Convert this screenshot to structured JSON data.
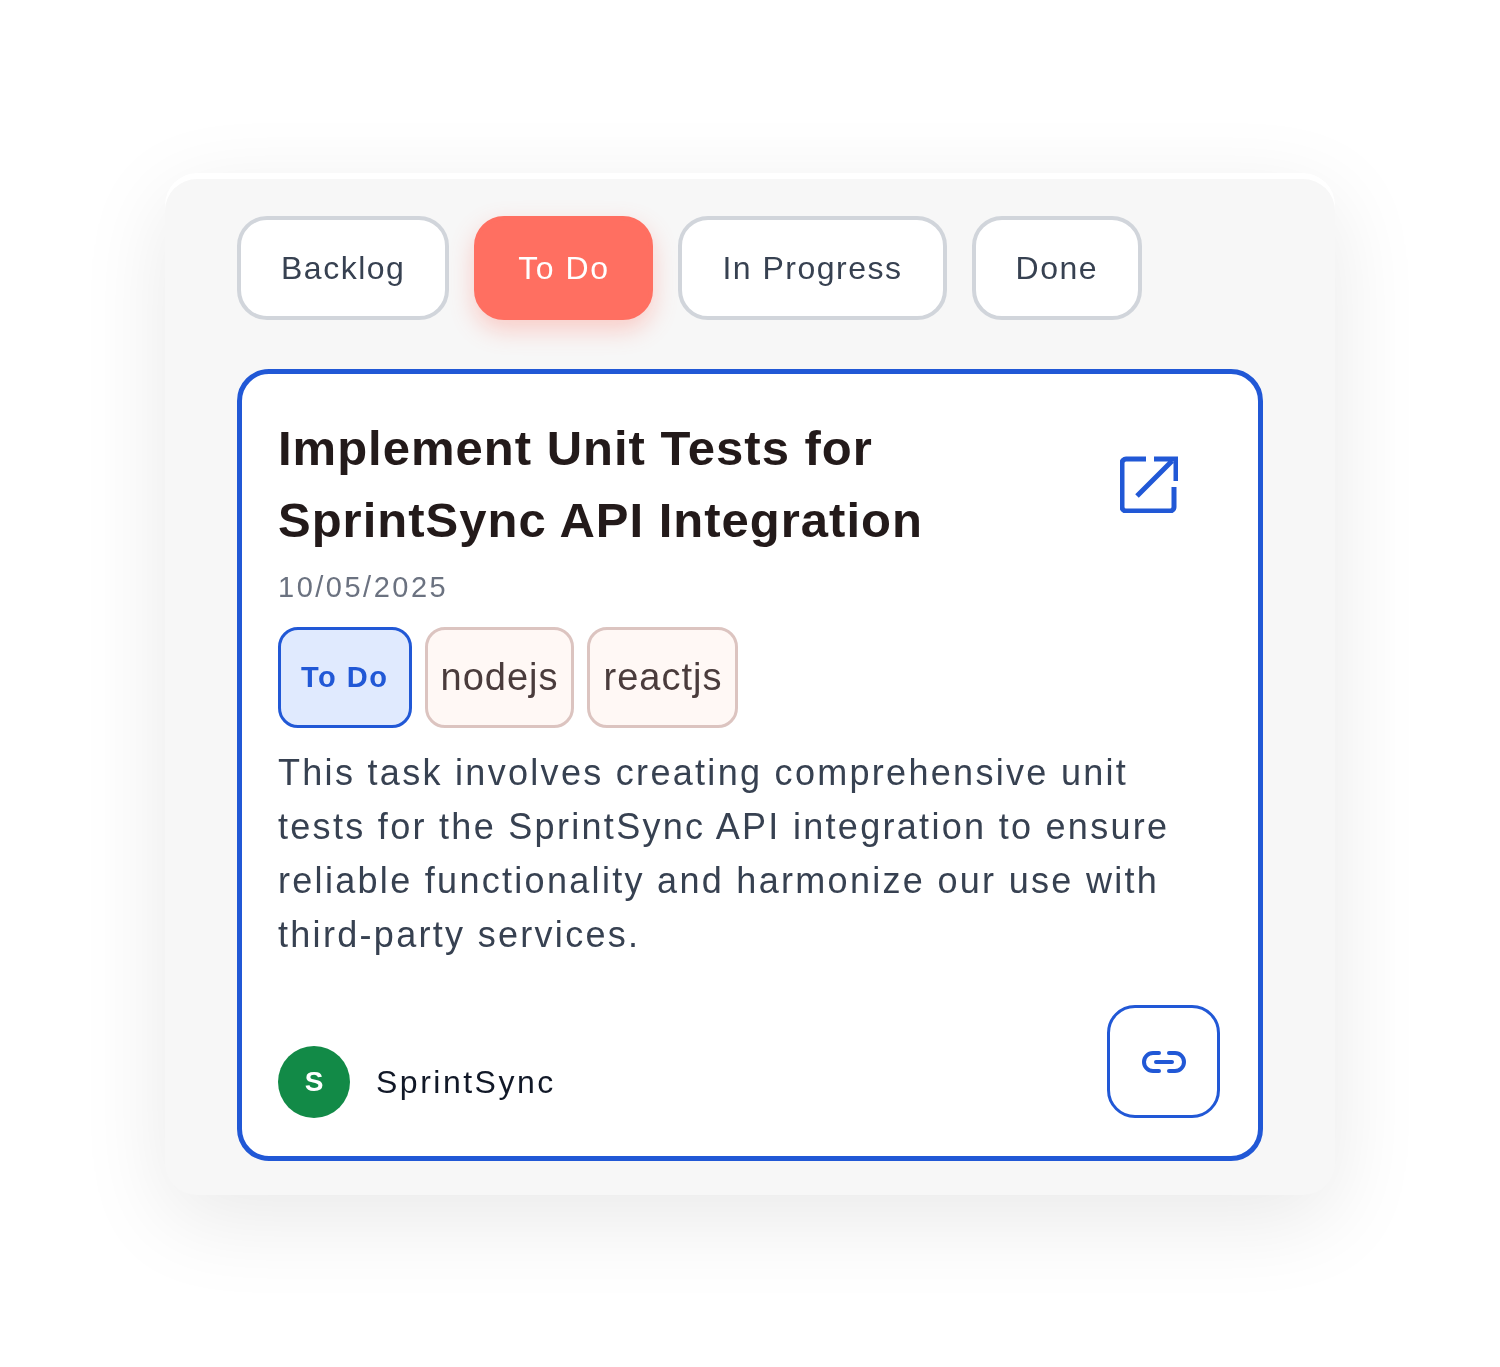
{
  "tabs": [
    {
      "label": "Backlog",
      "selected": false
    },
    {
      "label": "To Do",
      "selected": true
    },
    {
      "label": "In Progress",
      "selected": false
    },
    {
      "label": "Done",
      "selected": false
    }
  ],
  "task": {
    "title": "Implement Unit Tests for SprintSync API Integration",
    "date": "10/05/2025",
    "tags": [
      {
        "label": "To Do",
        "kind": "status"
      },
      {
        "label": "nodejs",
        "kind": "label"
      },
      {
        "label": "reactjs",
        "kind": "label"
      }
    ],
    "description": "This task involves creating comprehensive unit tests for the SprintSync API integration to ensure reliable functionality and harmonize our use with third-party services.",
    "owner": {
      "initial": "S",
      "name": "SprintSync"
    }
  }
}
